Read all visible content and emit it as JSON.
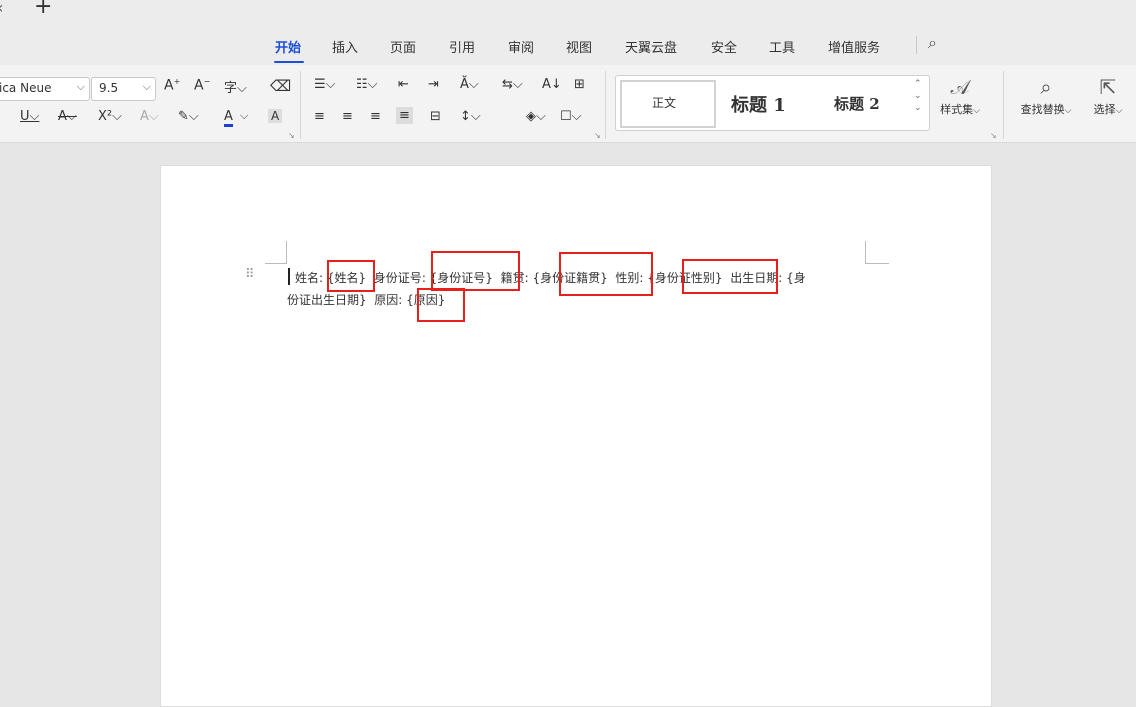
{
  "titlebar": {
    "close_glyph": "‹",
    "new_tab_glyph": "+"
  },
  "menu": {
    "items": [
      {
        "label": "开始",
        "active": true
      },
      {
        "label": "插入"
      },
      {
        "label": "页面"
      },
      {
        "label": "引用"
      },
      {
        "label": "审阅"
      },
      {
        "label": "视图"
      },
      {
        "label": "天翼云盘"
      },
      {
        "label": "安全"
      },
      {
        "label": "工具"
      },
      {
        "label": "增值服务"
      }
    ]
  },
  "ribbon": {
    "font_name": "ica Neue",
    "font_size": "9.5",
    "styles": {
      "normal": "正文",
      "heading1": "标题 1",
      "heading2": "标题 2"
    },
    "style_set_label": "样式集",
    "find_replace_label": "查找替换",
    "select_label": "选择"
  },
  "document": {
    "line1": {
      "name_label": "姓名",
      "name_value": "{姓名}",
      "id_label": "身份证号",
      "id_value": "{身份证号}",
      "native_label": "籍贯",
      "native_value": "{身份证籍贯}",
      "gender_label": "性别",
      "gender_value": "{身份证性别}",
      "birth_label": "出生日期",
      "birth_value_part": "{身"
    },
    "line2": {
      "birth_value_rest": "份证出生日期}",
      "reason_label": "原因",
      "reason_value": "{原因}"
    }
  },
  "colors": {
    "accent": "#1c4fd8",
    "highlight_box": "#e8201b"
  }
}
